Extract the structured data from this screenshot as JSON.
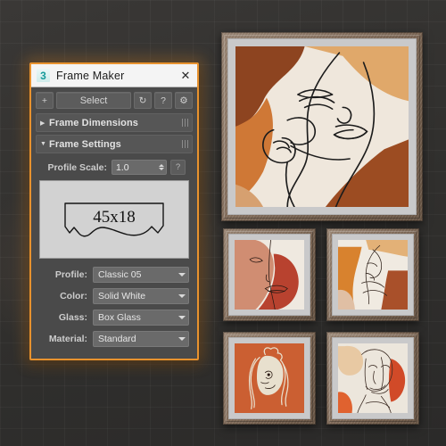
{
  "window": {
    "title": "Frame Maker",
    "icon": "max-logo-icon",
    "icon_glyph": "3",
    "close_label": "✕",
    "accent_color": "#e8922e"
  },
  "toolbar": {
    "add_label": "+",
    "select_label": "Select",
    "refresh_label": "↻",
    "help_label": "?",
    "settings_label": "⚙"
  },
  "rollouts": [
    {
      "label": "Frame Dimensions",
      "arrow": "▶",
      "expanded": false
    },
    {
      "label": "Frame Settings",
      "arrow": "▼",
      "expanded": true
    }
  ],
  "frame_settings": {
    "scale": {
      "label": "Profile Scale:",
      "value": "1.0",
      "help_label": "?"
    },
    "preview": {
      "dimension_text": "45x18"
    },
    "fields": [
      {
        "label": "Profile:",
        "value": "Classic 05"
      },
      {
        "label": "Color:",
        "value": "Solid White"
      },
      {
        "label": "Glass:",
        "value": "Box Glass"
      },
      {
        "label": "Material:",
        "value": "Standard"
      }
    ]
  },
  "gallery": {
    "frames": [
      {
        "name": "main-portrait",
        "title": "Line art face portrait"
      },
      {
        "name": "small-top-left",
        "title": "Two tone face closeup"
      },
      {
        "name": "small-top-right",
        "title": "Abstract figure"
      },
      {
        "name": "small-bot-left",
        "title": "Face with flowing hair"
      },
      {
        "name": "small-bot-right",
        "title": "Frontal face portrait"
      }
    ]
  }
}
